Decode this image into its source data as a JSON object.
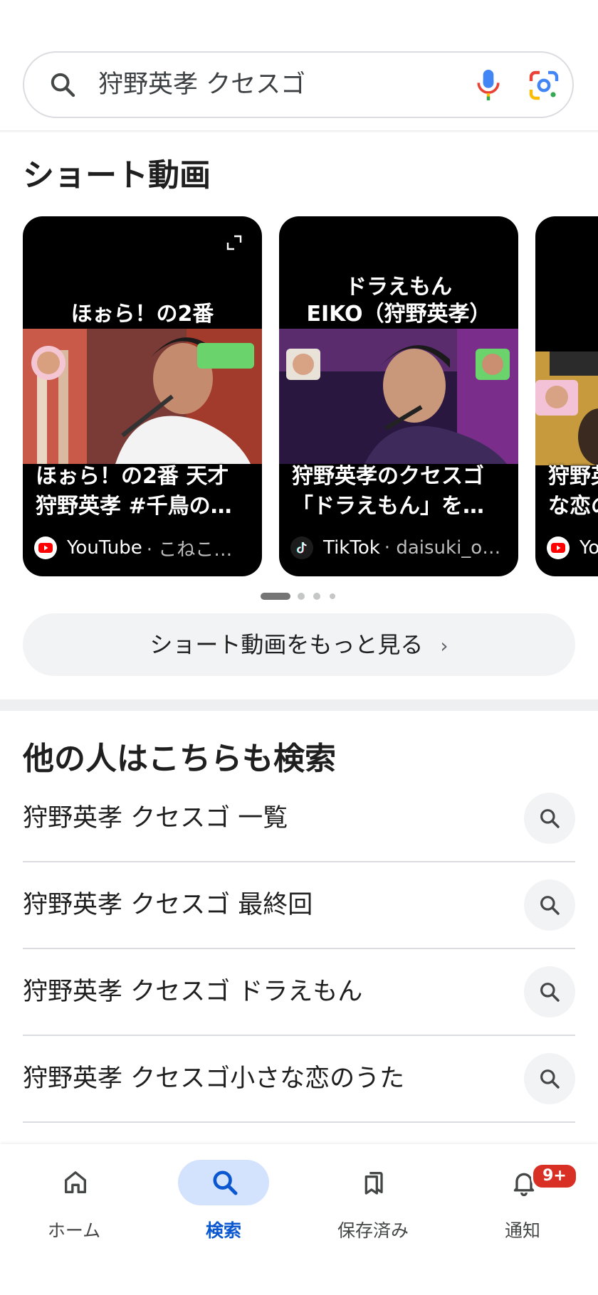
{
  "search": {
    "query": "狩野英孝 クセスゴ"
  },
  "shorts": {
    "heading": "ショート動画",
    "cards": [
      {
        "overlay_lines": [
          "ほぉら！の2番"
        ],
        "title_lines": [
          "ほぉら！の2番 天才",
          "狩野英孝 #千鳥の…"
        ],
        "platform": "YouTube",
        "channel": "· こねこ…",
        "platform_icon": "youtube-icon"
      },
      {
        "overlay_lines": [
          "ドラえもん",
          "EIKO（狩野英孝）"
        ],
        "title_lines": [
          "狩野英孝のクセスゴ",
          "「ドラえもん」を…"
        ],
        "platform": "TikTok",
        "channel": "· daisuki_o…",
        "platform_icon": "tiktok-icon"
      },
      {
        "overlay_lines": [
          ""
        ],
        "title_lines": [
          "狩野英",
          "な恋の"
        ],
        "platform": "Yo",
        "channel": "",
        "platform_icon": "youtube-icon"
      }
    ],
    "more_label": "ショート動画をもっと見る"
  },
  "related": {
    "heading": "他の人はこちらも検索",
    "items": [
      "狩野英孝 クセスゴ 一覧",
      "狩野英孝 クセスゴ 最終回",
      "狩野英孝 クセスゴ ドラえもん",
      "狩野英孝 クセスゴ小さな恋のうた"
    ]
  },
  "bottom_nav": {
    "items": [
      {
        "label": "ホーム",
        "icon": "home-icon",
        "active": false
      },
      {
        "label": "検索",
        "icon": "search-icon",
        "active": true
      },
      {
        "label": "保存済み",
        "icon": "saved-icon",
        "active": false
      },
      {
        "label": "通知",
        "icon": "bell-icon",
        "active": false,
        "badge": "9+"
      }
    ]
  },
  "colors": {
    "accent": "#0b57d0",
    "active_pill": "#d3e3fd",
    "badge": "#d93025",
    "youtube": "#ff0000"
  }
}
